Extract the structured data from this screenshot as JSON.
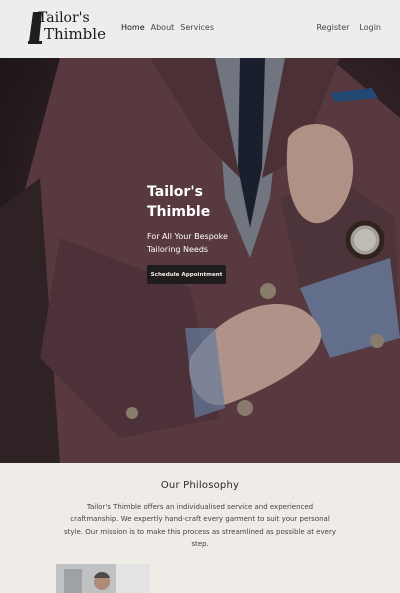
{
  "brand": {
    "logo_line1": "Tailor's",
    "logo_line2": "Thimble"
  },
  "nav": {
    "items": [
      {
        "label": "Home",
        "active": true
      },
      {
        "label": "About",
        "active": false
      },
      {
        "label": "Services",
        "active": false
      }
    ],
    "auth": [
      {
        "label": "Register"
      },
      {
        "label": "Login"
      }
    ]
  },
  "hero": {
    "title": "Tailor's Thimble",
    "subtitle": "For All Your Bespoke Tailoring Needs",
    "button_label": "Schedule Appointment"
  },
  "philosophy": {
    "title": "Our Philosophy",
    "body": "Tailor's Thimble offers an individualised service and experienced craftmanship. We expertly hand-craft every garment to suit your personal style. Our mission is to make this process as streamlined as possible at every step."
  },
  "colors": {
    "navbar_bg": "#eceeee",
    "hero_button_bg": "#1e1c1d",
    "philosophy_bg": "#efebe7",
    "jacket": "#6e4a52"
  }
}
